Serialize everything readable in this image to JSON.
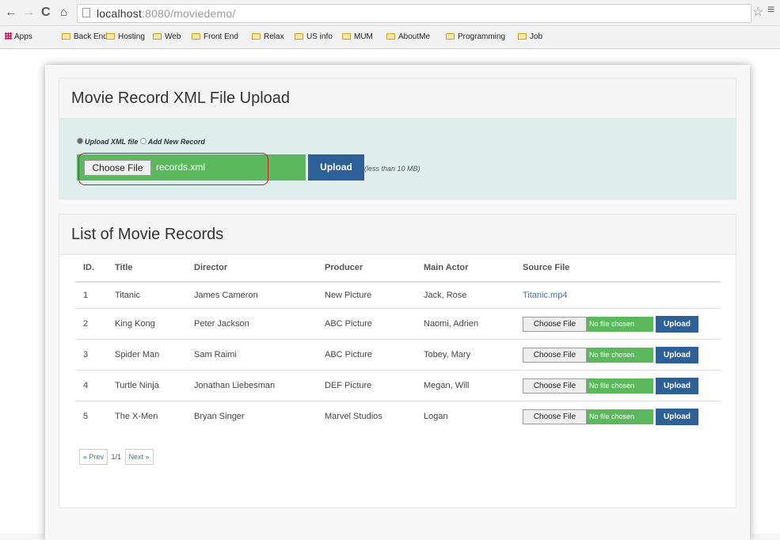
{
  "browser": {
    "url_host": "localhost",
    "url_rest": ":8080/moviedemo/",
    "bookmarks": [
      {
        "label": "Apps",
        "type": "apps"
      },
      {
        "label": "Back End",
        "type": "folder"
      },
      {
        "label": "Hosting",
        "type": "folder"
      },
      {
        "label": "Web",
        "type": "folder"
      },
      {
        "label": "Front End",
        "type": "folder"
      },
      {
        "label": "Relax",
        "type": "folder"
      },
      {
        "label": "US info",
        "type": "folder"
      },
      {
        "label": "MUM",
        "type": "folder"
      },
      {
        "label": "AboutMe",
        "type": "folder"
      },
      {
        "label": "Programming",
        "type": "folder"
      },
      {
        "label": "Job",
        "type": "folder"
      }
    ]
  },
  "upload_panel": {
    "title": "Movie Record XML File Upload",
    "radio_upload": "Upload XML file",
    "radio_add": "Add New Record",
    "choose_label": "Choose File",
    "file_name": "records.xml",
    "upload_label": "Upload",
    "hint": "(less than 10 MB)"
  },
  "records_panel": {
    "title": "List of Movie Records",
    "columns": [
      "ID.",
      "Title",
      "Director",
      "Producer",
      "Main Actor",
      "Source File"
    ],
    "rows": [
      {
        "id": "1",
        "title": "Titanic",
        "director": "James Cameron",
        "producer": "New Picture",
        "actor": "Jack, Rose",
        "source": "Titanic.mp4"
      },
      {
        "id": "2",
        "title": "King Kong",
        "director": "Peter Jackson",
        "producer": "ABC Picture",
        "actor": "Naomi, Adrien",
        "source": ""
      },
      {
        "id": "3",
        "title": "Spider Man",
        "director": "Sam Raimi",
        "producer": "ABC Picture",
        "actor": "Tobey, Mary",
        "source": ""
      },
      {
        "id": "4",
        "title": "Turtle Ninja",
        "director": "Jonathan Liebesman",
        "producer": "DEF Picture",
        "actor": "Megan, Will",
        "source": ""
      },
      {
        "id": "5",
        "title": "The X-Men",
        "director": "Bryan Singer",
        "producer": "Marvel Studios",
        "actor": "Logan",
        "source": ""
      }
    ],
    "row_choose_label": "Choose File",
    "row_no_file": "No file chosen",
    "row_upload_label": "Upload",
    "pager": {
      "prev": "« Prev",
      "info": "1/1",
      "next": "Next »"
    }
  },
  "colors": {
    "primary": "#2c6096",
    "success": "#5cb85c",
    "highlight": "#b22222"
  }
}
